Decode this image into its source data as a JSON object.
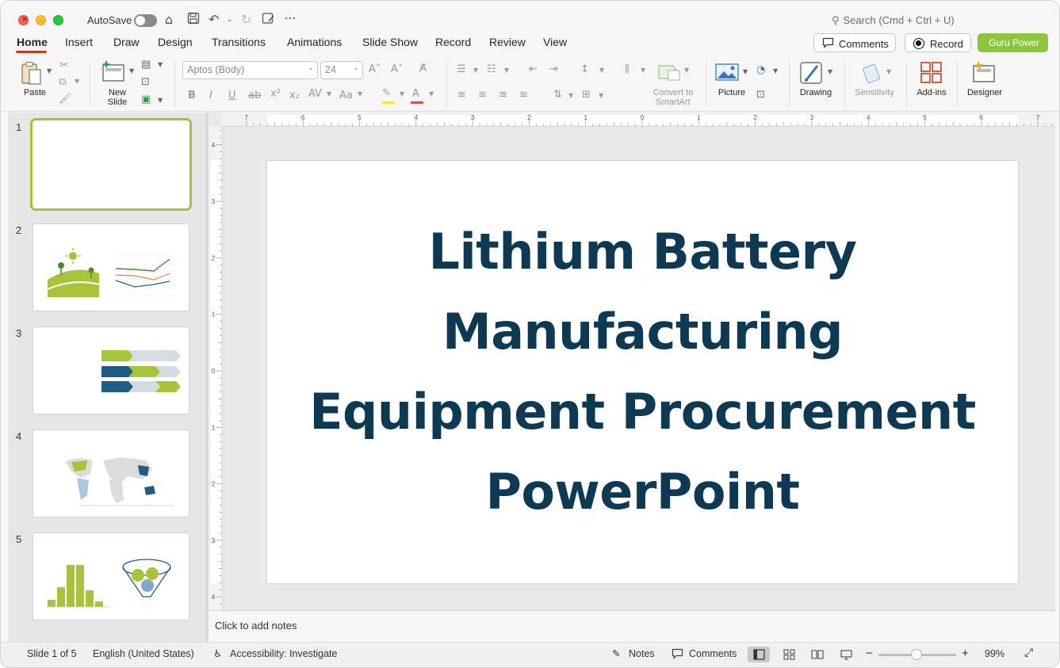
{
  "titlebar": {
    "autosave_label": "AutoSave",
    "search_placeholder": "Search (Cmd + Ctrl + U)"
  },
  "tabs": [
    {
      "label": "Home"
    },
    {
      "label": "Insert"
    },
    {
      "label": "Draw"
    },
    {
      "label": "Design"
    },
    {
      "label": "Transitions"
    },
    {
      "label": "Animations"
    },
    {
      "label": "Slide Show"
    },
    {
      "label": "Record"
    },
    {
      "label": "Review"
    },
    {
      "label": "View"
    }
  ],
  "header_buttons": {
    "comments": "Comments",
    "record": "Record",
    "guru": "Guru Power"
  },
  "ribbon": {
    "paste": "Paste",
    "new_slide_line1": "New",
    "new_slide_line2": "Slide",
    "font_name": "Aptos (Body)",
    "font_size": "24",
    "convert_line1": "Convert to",
    "convert_line2": "SmartArt",
    "picture": "Picture",
    "drawing": "Drawing",
    "sensitivity": "Sensitivity",
    "addins": "Add-ins",
    "designer": "Designer"
  },
  "thumbnails": [
    {
      "num": "1"
    },
    {
      "num": "2"
    },
    {
      "num": "3"
    },
    {
      "num": "4"
    },
    {
      "num": "5"
    }
  ],
  "slide": {
    "title_line1": "Lithium Battery",
    "title_line2": "Manufacturing",
    "title_line3": "Equipment Procurement",
    "title_line4": "PowerPoint"
  },
  "notes": {
    "placeholder": "Click to add notes"
  },
  "status": {
    "slide_count": "Slide 1 of 5",
    "language": "English (United States)",
    "accessibility": "Accessibility: Investigate",
    "notes": "Notes",
    "comments": "Comments",
    "zoom_percent": "99%",
    "zoom_value": 0.99
  },
  "colors": {
    "title_color": "#0d3a52",
    "accent_tab": "#c43e1c",
    "guru_green": "#8cc63f",
    "selected_thumb_border": "#a9be3a"
  }
}
